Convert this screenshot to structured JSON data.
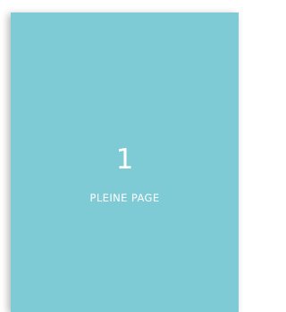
{
  "page": {
    "number": "1",
    "label": "PLEINE PAGE",
    "background_color": "#7ecbd6",
    "text_color": "#ffffff"
  }
}
